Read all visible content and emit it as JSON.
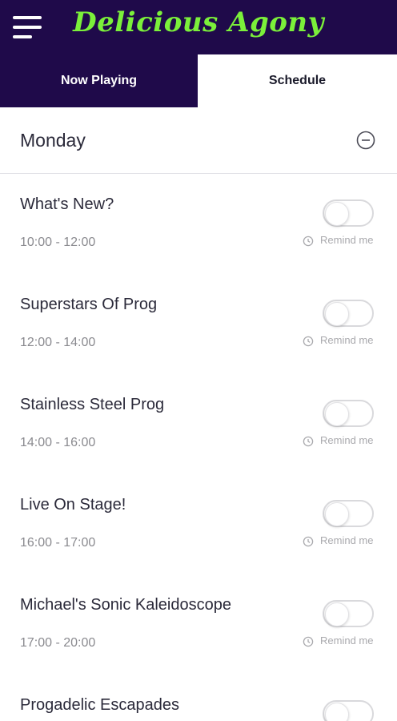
{
  "header": {
    "title": "Delicious Agony",
    "menu_icon": "hamburger-menu-icon"
  },
  "tabs": [
    {
      "label": "Now Playing",
      "active": false
    },
    {
      "label": "Schedule",
      "active": true
    }
  ],
  "colors": {
    "brand_bg": "#1f0a4a",
    "title_color": "#7bf03a"
  },
  "schedule": {
    "day": "Monday",
    "shows": [
      {
        "title": "What's New?",
        "time": "10:00 - 12:00",
        "remind_label": "Remind me",
        "reminder_on": false
      },
      {
        "title": "Superstars Of Prog",
        "time": "12:00 - 14:00",
        "remind_label": "Remind me",
        "reminder_on": false
      },
      {
        "title": "Stainless Steel Prog",
        "time": "14:00 - 16:00",
        "remind_label": "Remind me",
        "reminder_on": false
      },
      {
        "title": "Live On Stage!",
        "time": "16:00 - 17:00",
        "remind_label": "Remind me",
        "reminder_on": false
      },
      {
        "title": "Michael's Sonic Kaleidoscope",
        "time": "17:00 - 20:00",
        "remind_label": "Remind me",
        "reminder_on": false
      },
      {
        "title": "Progadelic Escapades",
        "reminder_on": false
      }
    ]
  }
}
